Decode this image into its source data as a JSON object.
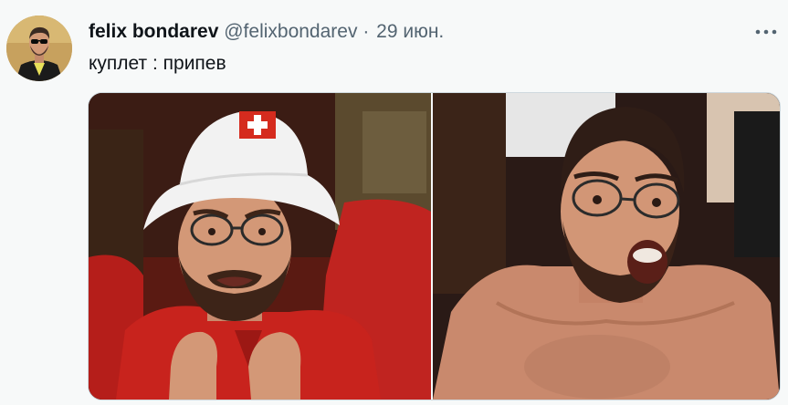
{
  "tweet": {
    "author_name": "felix bondarev",
    "author_handle": "@felixbondarev",
    "separator": "·",
    "date": "29 июн.",
    "text": "куплет : припев"
  },
  "icons": {
    "more": "more-horizontal-icon"
  },
  "media": {
    "count": 2
  },
  "colors": {
    "background": "#f7f9f9",
    "text": "#0f1419",
    "secondary_text": "#536471",
    "border": "#cfd9de"
  }
}
